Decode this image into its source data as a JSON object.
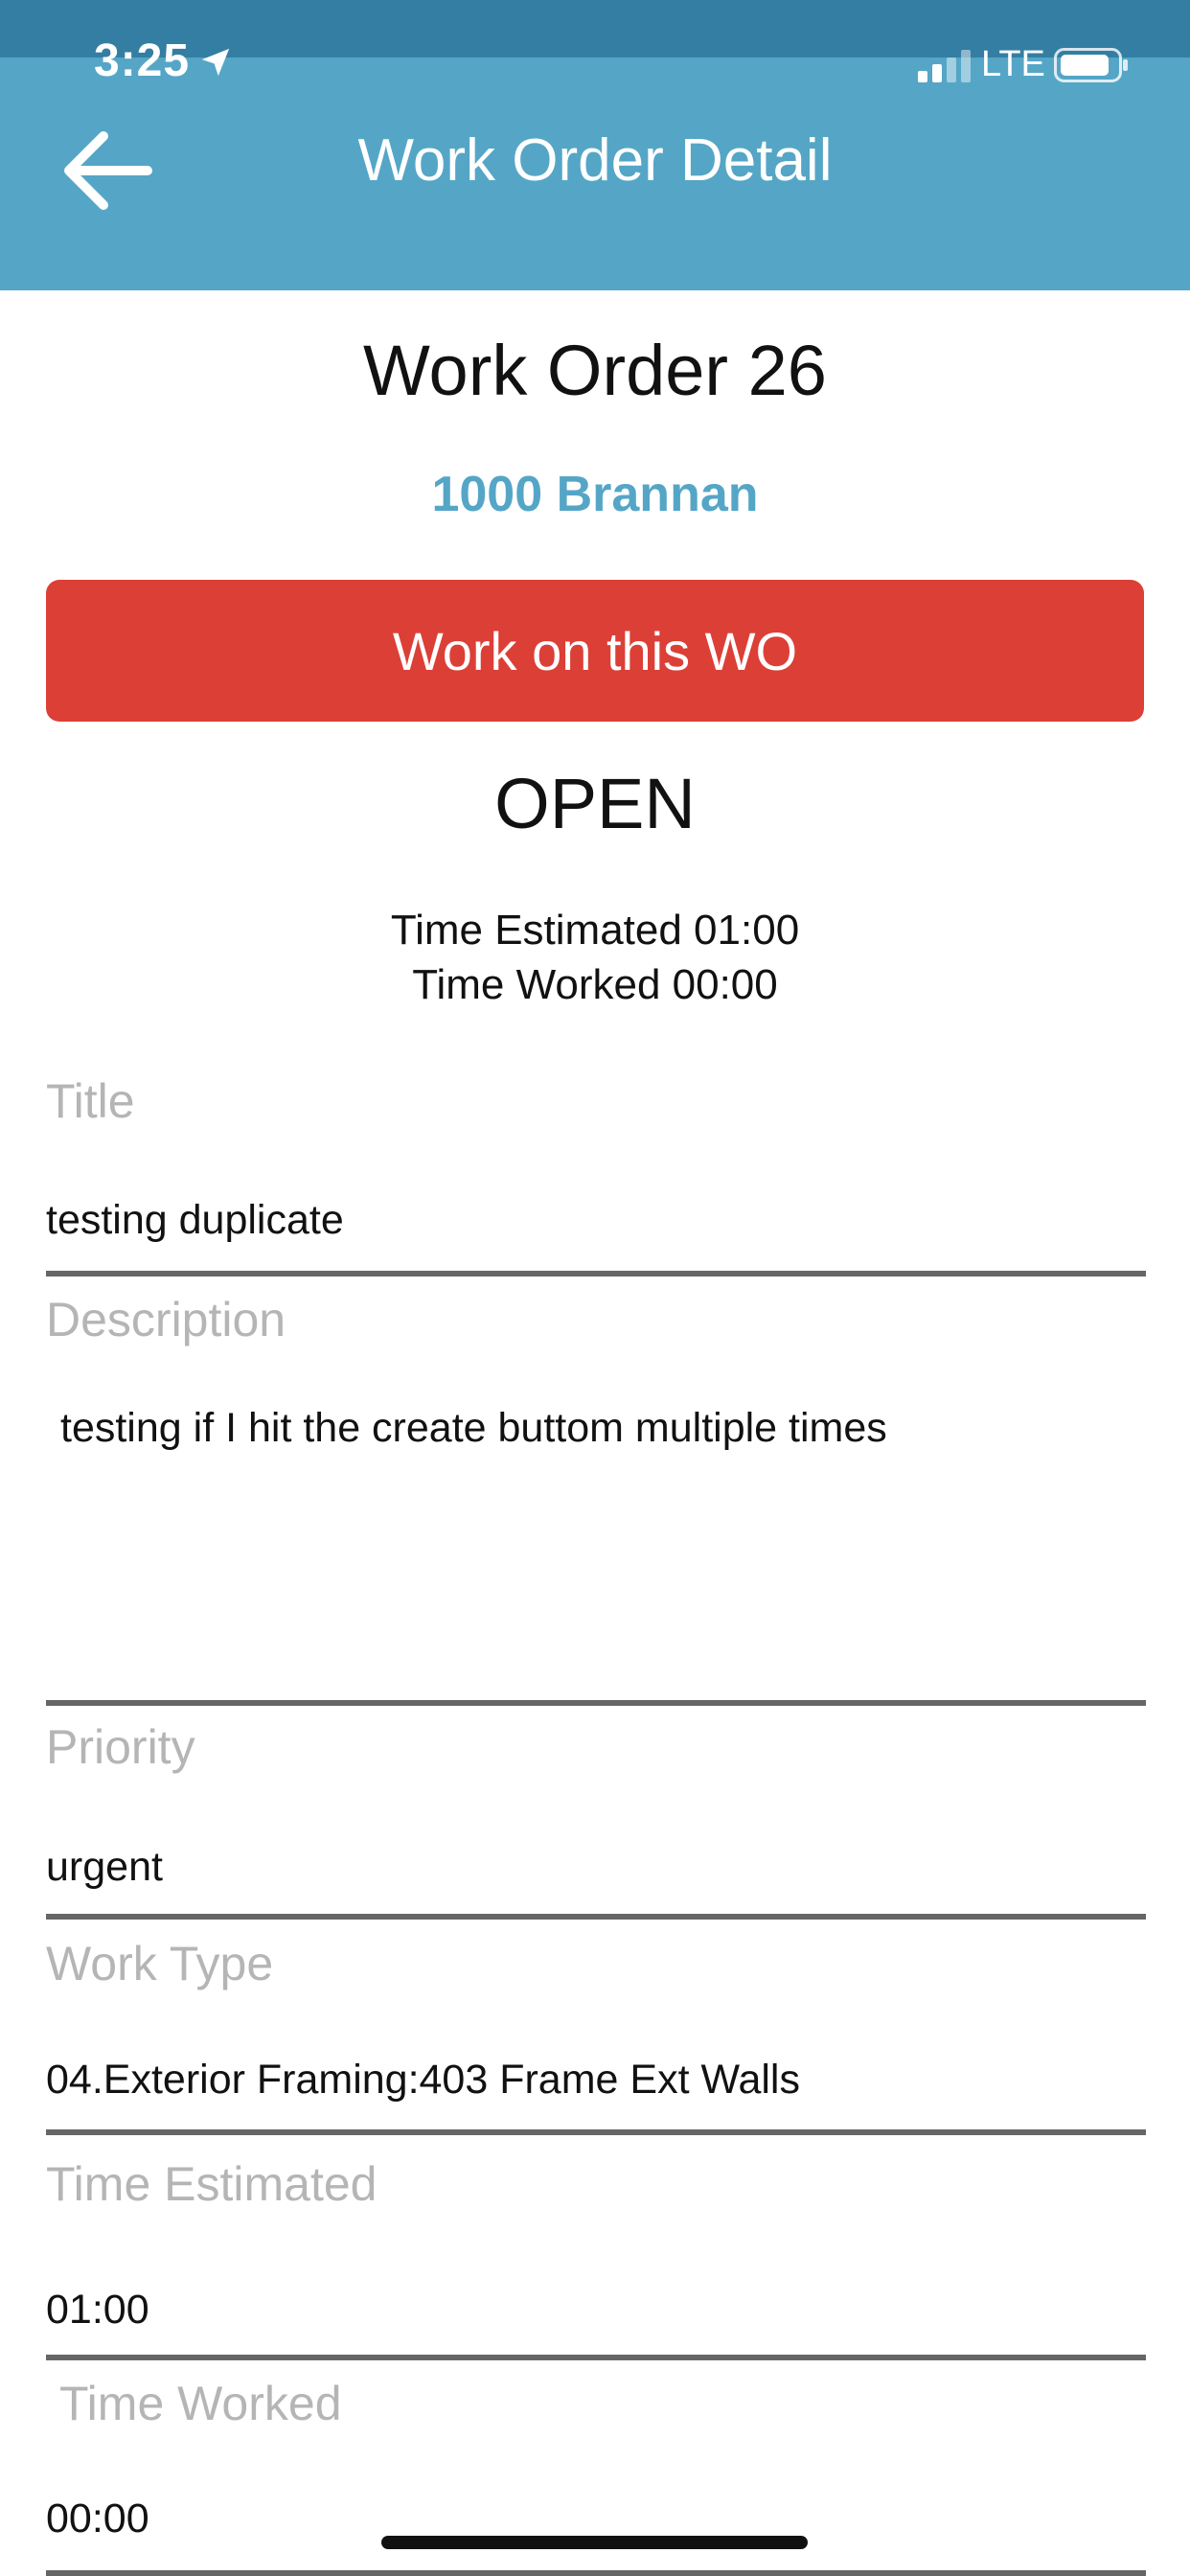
{
  "status_bar": {
    "time": "3:25",
    "network": "LTE",
    "location_icon": "location-arrow-icon",
    "signal_icon": "cellular-signal-icon",
    "battery_icon": "battery-icon"
  },
  "header": {
    "title": "Work Order Detail",
    "back_icon": "arrow-left-icon",
    "color": "#55a6c6"
  },
  "work_order": {
    "title": "Work Order 26",
    "location": "1000 Brannan",
    "action_label": "Work on this WO",
    "action_color": "#dc3f36",
    "status": "OPEN",
    "time_estimated_summary": "Time Estimated 01:00",
    "time_worked_summary": "Time Worked 00:00"
  },
  "fields": {
    "title": {
      "label": "Title",
      "value": "testing duplicate"
    },
    "description": {
      "label": "Description",
      "value": "testing if I hit the create buttom multiple times"
    },
    "priority": {
      "label": "Priority",
      "value": "urgent"
    },
    "work_type": {
      "label": "Work Type",
      "value": "04.Exterior Framing:403 Frame Ext Walls"
    },
    "time_estimated": {
      "label": "Time Estimated",
      "value": "01:00"
    },
    "time_worked": {
      "label": "Time Worked",
      "value": "00:00"
    }
  }
}
